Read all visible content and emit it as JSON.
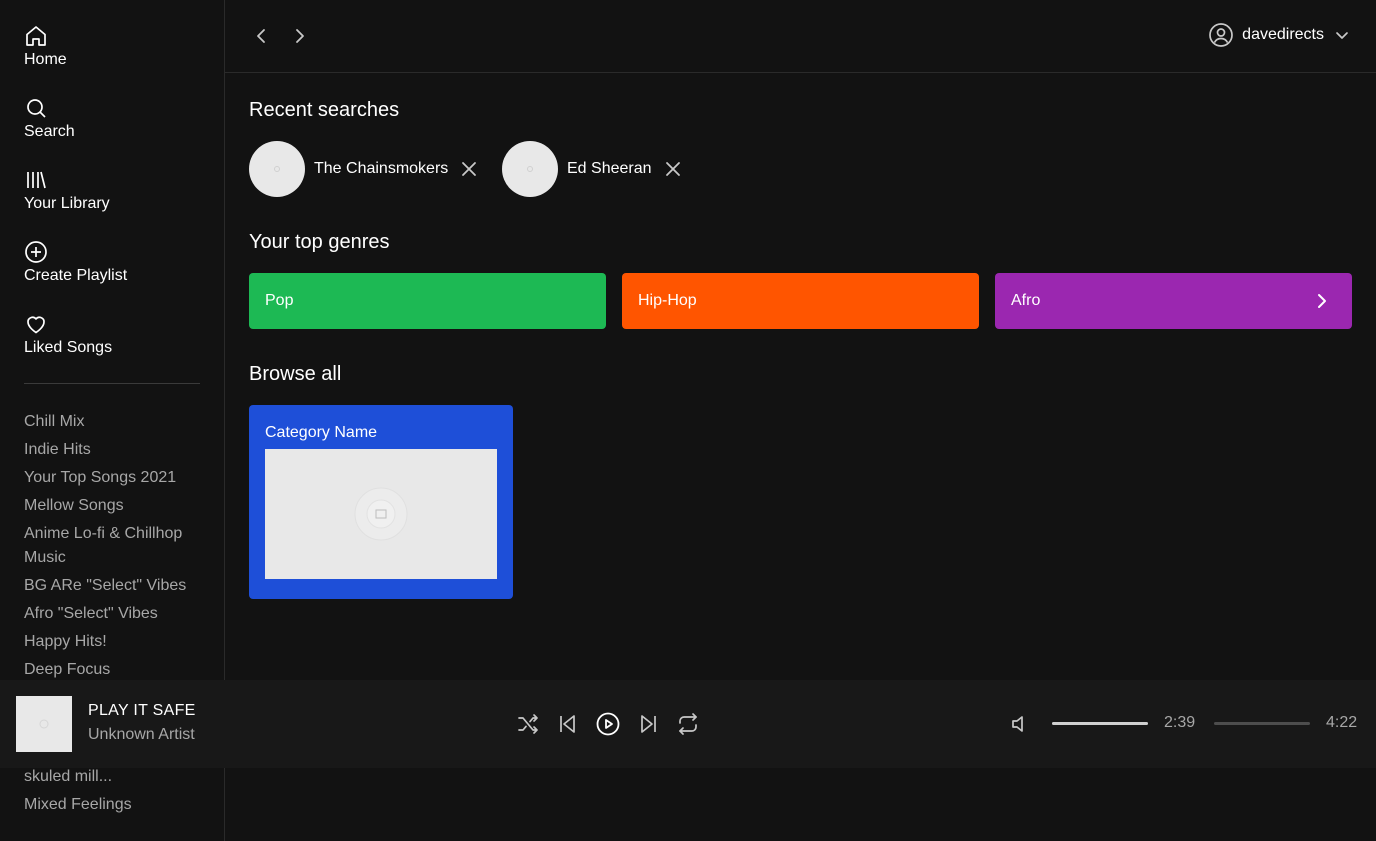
{
  "sidebar": {
    "nav": [
      {
        "label": "Home",
        "icon": "home-icon"
      },
      {
        "label": "Search",
        "icon": "search-icon"
      },
      {
        "label": "Your Library",
        "icon": "library-icon"
      },
      {
        "label": "Create Playlist",
        "icon": "plus-circle-icon"
      },
      {
        "label": "Liked Songs",
        "icon": "heart-icon"
      }
    ],
    "playlists": [
      "Chill Mix",
      "Indie Hits",
      "Your Top Songs 2021",
      "Mellow Songs",
      "Anime Lo-fi & Chillhop Music",
      "BG ARe \"Select\" Vibes",
      "Afro \"Select\" Vibes",
      "Happy Hits!",
      "Deep Focus",
      "skuled mill...",
      "Mixed Feelings"
    ]
  },
  "topbar": {
    "username": "davedirects"
  },
  "main": {
    "recent_title": "Recent searches",
    "recent": [
      {
        "name": "The Chainsmokers"
      },
      {
        "name": "Ed Sheeran"
      }
    ],
    "genres_title": "Your top genres",
    "genres": [
      {
        "label": "Pop",
        "color": "#1db954"
      },
      {
        "label": "Hip-Hop",
        "color": "#ff5500"
      },
      {
        "label": "Afro",
        "color": "#9b27b0"
      }
    ],
    "browse_title": "Browse all",
    "categories": [
      {
        "name": "Category Name",
        "color": "#1e4fd8"
      }
    ]
  },
  "player": {
    "title": "PLAY IT SAFE",
    "artist": "Unknown Artist",
    "elapsed": "2:39",
    "duration": "4:22",
    "volume_fraction": 1.0,
    "progress_fraction": 0.0
  }
}
